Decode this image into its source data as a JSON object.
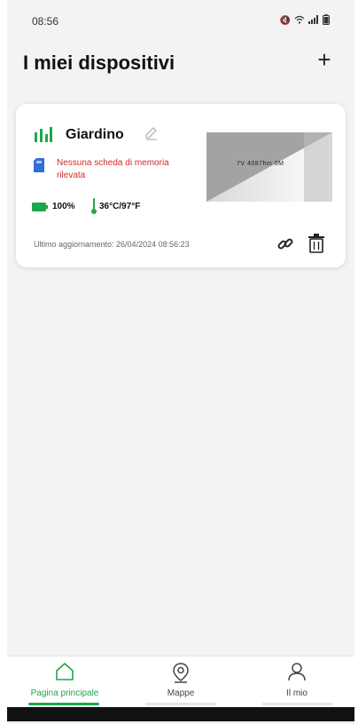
{
  "status_bar": {
    "time": "08:56",
    "icons": [
      "mute-icon",
      "wifi-icon",
      "signal-icon",
      "battery-icon"
    ]
  },
  "header": {
    "title": "I miei dispositivi",
    "add_label": "+"
  },
  "device": {
    "name": "Giardino",
    "sd_warning": "Nessuna scheda di memoria rilevata",
    "battery": "100%",
    "temperature": "36°C/97°F",
    "thumbnail_text": "7V 4087hm 0M",
    "last_update": "Ultimo aggiornamento: 26/04/2024 08:56:23",
    "status_colors": {
      "signal": "#1fa64a",
      "battery": "#1fa64a",
      "thermometer": "#1fa64a",
      "warning": "#d12b2b"
    }
  },
  "nav": {
    "items": [
      {
        "label": "Pagina principale",
        "icon": "home-icon",
        "active": true
      },
      {
        "label": "Mappe",
        "icon": "map-pin-icon",
        "active": false
      },
      {
        "label": "Il mio",
        "icon": "user-icon",
        "active": false
      }
    ],
    "accent": "#1fa64a"
  }
}
